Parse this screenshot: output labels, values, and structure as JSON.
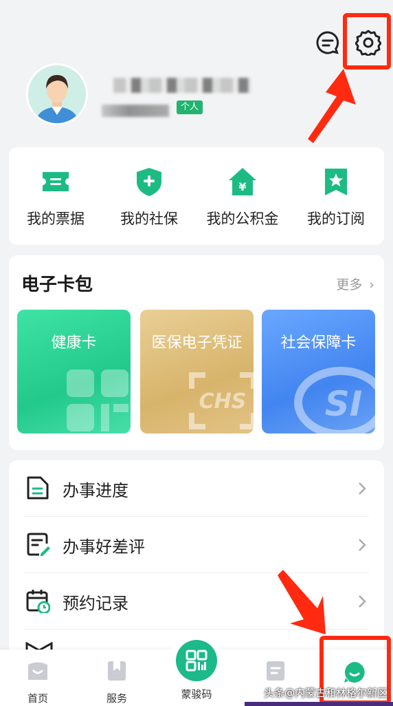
{
  "header": {
    "message_icon": "chat-bubble-icon",
    "settings_icon": "gear-icon"
  },
  "profile": {
    "badge": "个人"
  },
  "quick_actions": [
    {
      "label": "我的票据",
      "icon": "ticket-icon"
    },
    {
      "label": "我的社保",
      "icon": "shield-plus-icon"
    },
    {
      "label": "我的公积金",
      "icon": "house-yen-icon"
    },
    {
      "label": "我的订阅",
      "icon": "bookmark-star-icon"
    }
  ],
  "wallet": {
    "title": "电子卡包",
    "more": "更多",
    "cards": [
      {
        "label": "健康卡",
        "color": "#22c98b"
      },
      {
        "label": "医保电子凭证",
        "color": "#d8b46b"
      },
      {
        "label": "社会保障卡",
        "color": "#4285f0"
      }
    ]
  },
  "services": [
    {
      "label": "办事进度",
      "icon": "document-icon"
    },
    {
      "label": "办事好差评",
      "icon": "rating-edit-icon"
    },
    {
      "label": "预约记录",
      "icon": "calendar-clock-icon"
    }
  ],
  "nav": {
    "items": [
      {
        "label": "首页",
        "icon": "home-icon"
      },
      {
        "label": "服务",
        "icon": "bookmark-icon"
      },
      {
        "label": "蒙骏码",
        "icon": "qr-code-icon"
      },
      {
        "label": "",
        "icon": "file-icon"
      },
      {
        "label": "",
        "icon": "smile-user-icon"
      }
    ]
  },
  "watermark": "头条@内蒙古和林格尔新区",
  "accent": "#21b36f",
  "highlight_color": "#ff2a10"
}
